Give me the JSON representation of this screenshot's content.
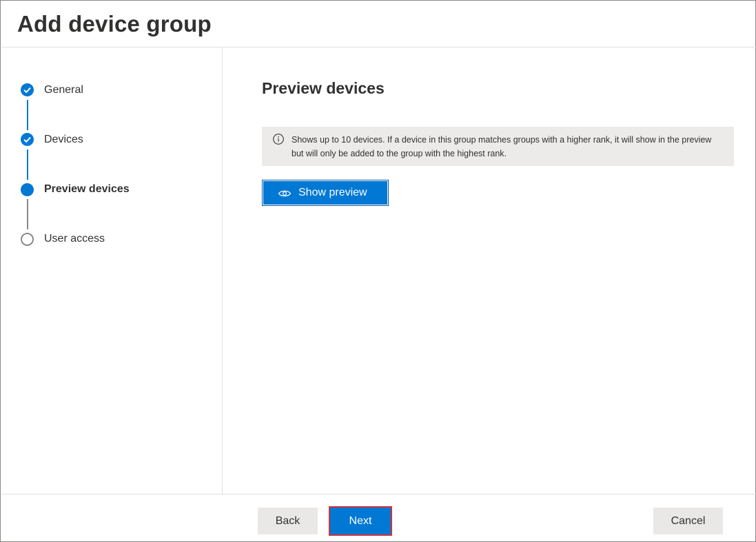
{
  "header": {
    "title": "Add device group"
  },
  "steps": [
    {
      "label": "General",
      "state": "done",
      "icon": "check-icon"
    },
    {
      "label": "Devices",
      "state": "done",
      "icon": "check-icon"
    },
    {
      "label": "Preview devices",
      "state": "current",
      "icon": "current-step-dot-icon"
    },
    {
      "label": "User access",
      "state": "todo",
      "icon": "empty-circle-icon"
    }
  ],
  "main": {
    "title": "Preview devices",
    "info": {
      "icon": "info-icon",
      "text": "Shows up to 10 devices. If a device in this group matches groups with a higher rank, it will show in the preview but will only be added to the group with the highest rank."
    },
    "show_preview": {
      "label": "Show preview",
      "icon": "eye-icon"
    }
  },
  "footer": {
    "back_label": "Back",
    "next_label": "Next",
    "cancel_label": "Cancel"
  },
  "colors": {
    "accent": "#0078d4",
    "highlight_outline": "#d13438",
    "info_background": "#edebe9"
  }
}
